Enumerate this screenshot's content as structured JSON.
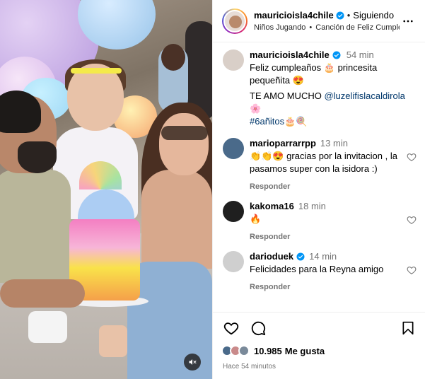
{
  "header": {
    "username": "mauricioisla4chile",
    "separator": "•",
    "follow_status": "Siguiendo",
    "audio_artist": "Niños Jugando",
    "audio_separator": "•",
    "audio_title": "Canción de Feliz Cumple…"
  },
  "caption": {
    "username": "mauricioisla4chile",
    "time": "54 min",
    "line1": "Feliz cumpleaños 🎂 princesita pequeñita 😍",
    "line2_prefix": "TE AMO MUCHO ",
    "mention": "@luzelifislacaldirola",
    "line2_suffix": " 🌸",
    "hashtag": "#6añitos",
    "hashtag_suffix": "🎂🍭"
  },
  "comments": [
    {
      "username": "marioparrarrpp",
      "time": "13 min",
      "text": "👏👏😍 gracias por la invitacion , la pasamos super con la isidora :)",
      "reply_label": "Responder"
    },
    {
      "username": "kakoma16",
      "time": "18 min",
      "text": "🔥",
      "reply_label": "Responder"
    },
    {
      "username": "darioduek",
      "time": "14 min",
      "text": "Felicidades para la Reyna amigo",
      "reply_label": "Responder"
    }
  ],
  "likes": {
    "count": "10.985",
    "label": "Me gusta"
  },
  "post_time": "Hace 54 minutos",
  "colors": {
    "verified": "#0095f6",
    "link": "#00376b",
    "muted": "#737373",
    "border": "#efefef"
  },
  "icons": {
    "verified": "verified-badge-icon",
    "more": "more-options-icon",
    "like": "heart-icon",
    "comment": "comment-icon",
    "save": "bookmark-icon",
    "mute": "muted-speaker-icon"
  }
}
